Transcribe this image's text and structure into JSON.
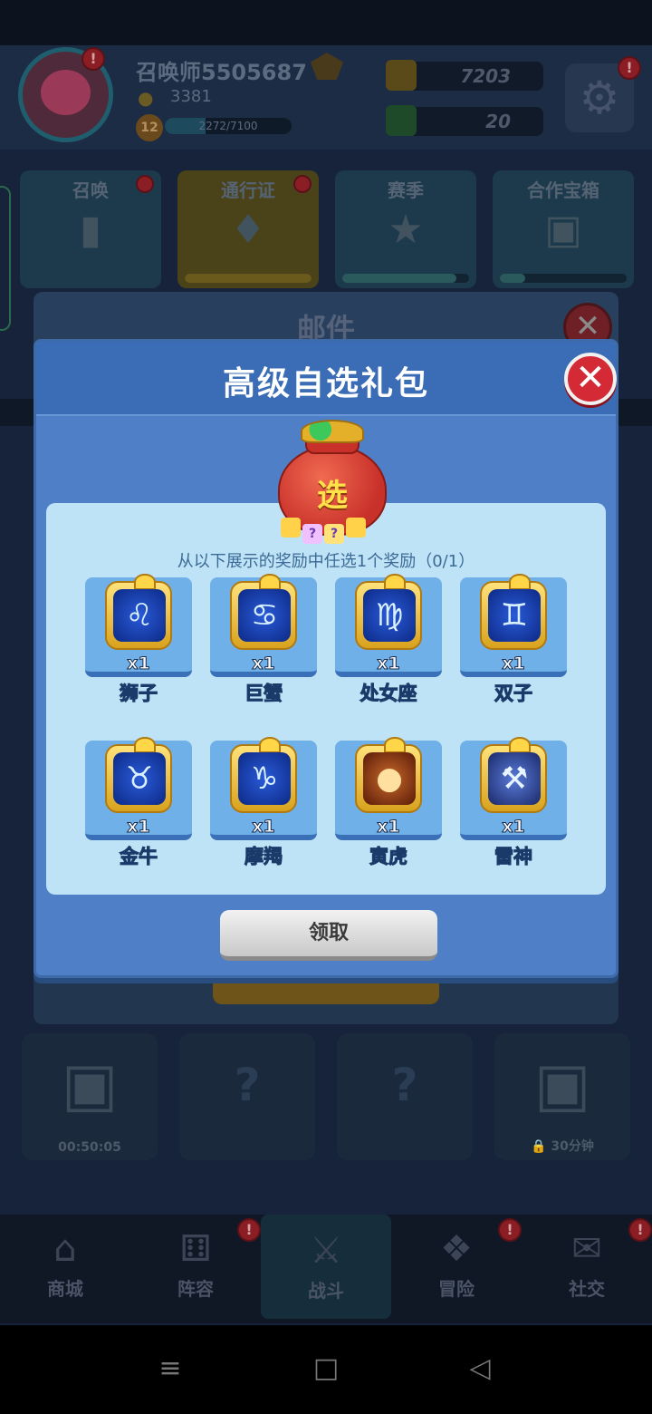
{
  "player": {
    "name": "召唤师5505687",
    "trophies": "3381",
    "level": "12",
    "xp": "2272/7100",
    "xp_fraction": 0.32,
    "avatar_badge": "!",
    "gold": "7203",
    "gems": "20",
    "settings_badge": "!"
  },
  "features": [
    {
      "label": "召唤",
      "badge": true,
      "progress": 0
    },
    {
      "label": "通行证",
      "badge": true,
      "progress": 0.0
    },
    {
      "label": "赛季",
      "badge": false,
      "progress": 0.9
    },
    {
      "label": "合作宝箱",
      "badge": false,
      "progress": 0.2
    }
  ],
  "chests": [
    {
      "type": "chest",
      "text": "00:50:05"
    },
    {
      "type": "locked",
      "text": ""
    },
    {
      "type": "locked",
      "text": ""
    },
    {
      "type": "chest",
      "text": "30分钟"
    }
  ],
  "nav": [
    {
      "label": "商城",
      "icon": "shop-icon",
      "badge": false
    },
    {
      "label": "阵容",
      "icon": "dice-icon",
      "badge": true
    },
    {
      "label": "战斗",
      "icon": "crossed-swords-icon",
      "badge": false,
      "active": true
    },
    {
      "label": "冒险",
      "icon": "compass-icon",
      "badge": true
    },
    {
      "label": "社交",
      "icon": "chat-icon",
      "badge": true
    }
  ],
  "mail": {
    "title": "邮件"
  },
  "gift": {
    "title": "高级自选礼包",
    "bag_char": "选",
    "instruction": "从以下展示的奖励中任选1个奖励（0/1）",
    "claim_label": "领取",
    "rewards": [
      {
        "name": "狮子",
        "qty": "x1",
        "icon": "lion-icon"
      },
      {
        "name": "巨蟹",
        "qty": "x1",
        "icon": "crab-icon"
      },
      {
        "name": "处女座",
        "qty": "x1",
        "icon": "virgo-icon"
      },
      {
        "name": "双子",
        "qty": "x1",
        "icon": "gemini-icon"
      },
      {
        "name": "金牛",
        "qty": "x1",
        "icon": "bull-icon"
      },
      {
        "name": "摩羯",
        "qty": "x1",
        "icon": "capricorn-icon"
      },
      {
        "name": "寅虎",
        "qty": "x1",
        "icon": "tiger-icon"
      },
      {
        "name": "雷神",
        "qty": "x1",
        "icon": "thor-hammer-icon"
      }
    ]
  }
}
